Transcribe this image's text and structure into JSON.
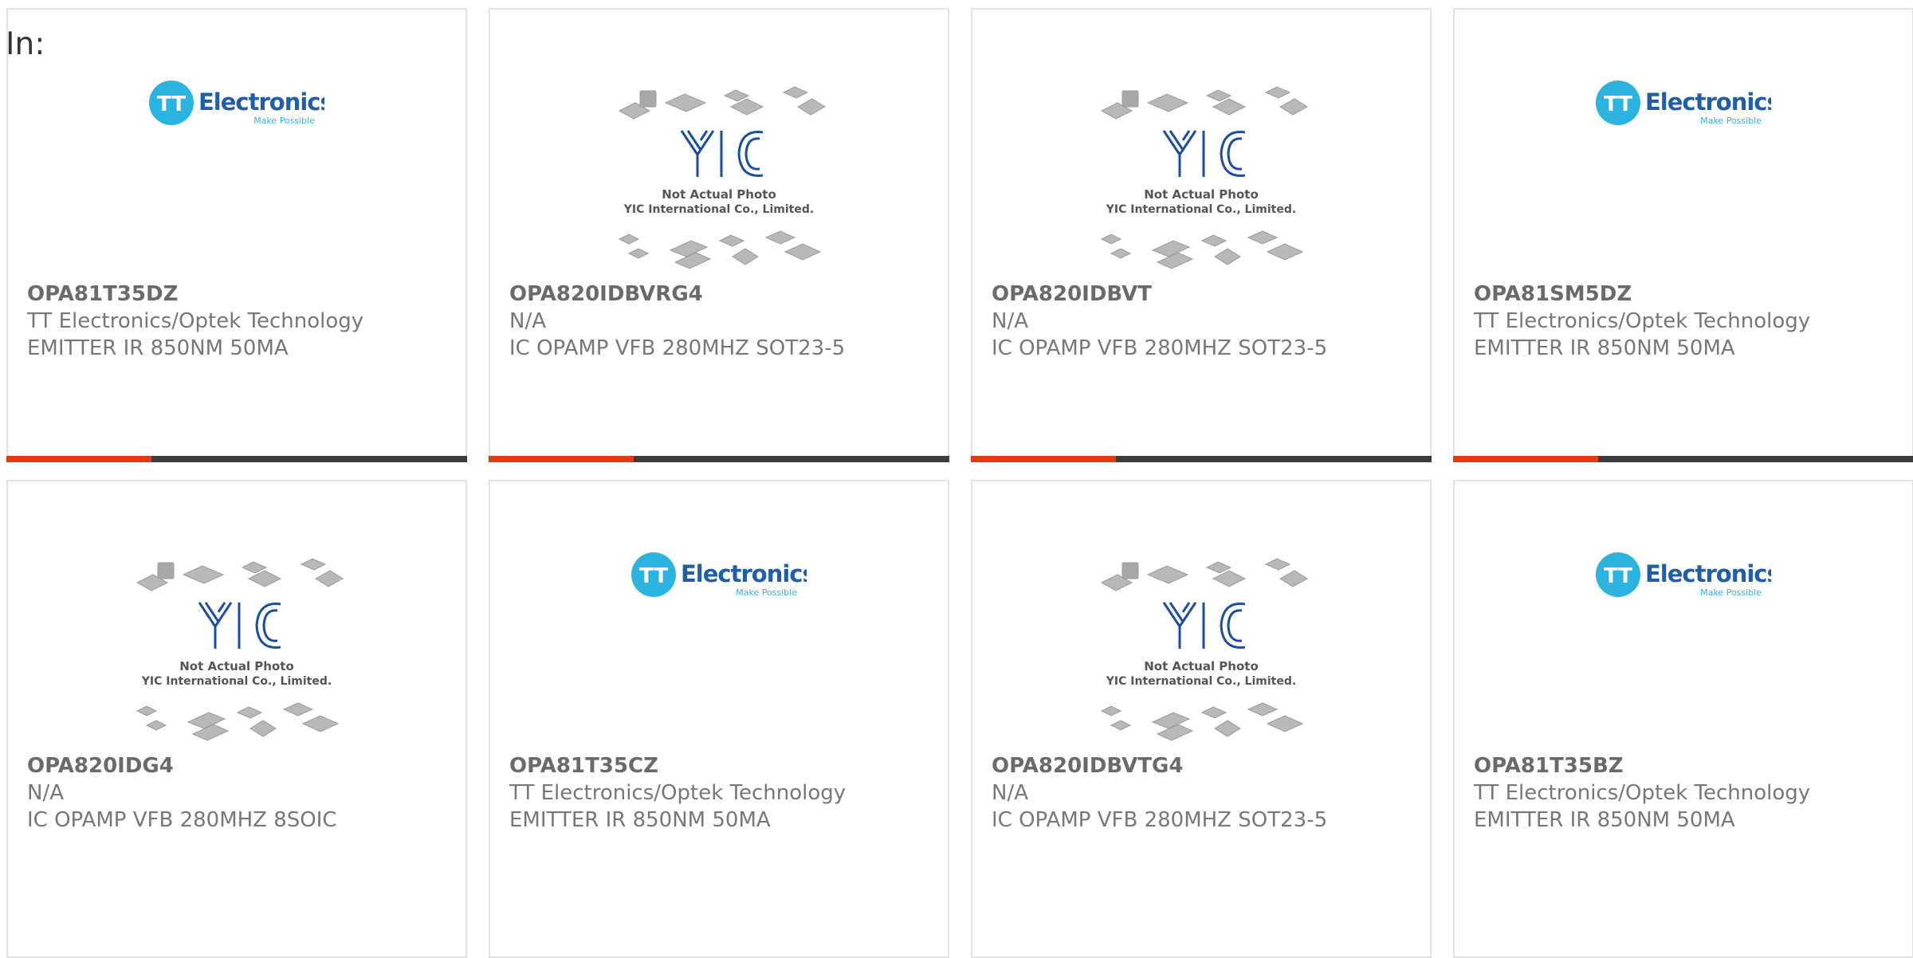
{
  "header": {
    "in_label": "In:"
  },
  "colors": {
    "tt_blue": "#2bb4e0",
    "yic_blue": "#1a4f9e",
    "accent_bar": "#e23a0e",
    "dark_bar": "#3c3c3c"
  },
  "logos": {
    "tt": {
      "main": "Electronics",
      "tagline": "Make Possible",
      "badge": "TT"
    },
    "yic": {
      "mark": "YIC",
      "line1": "Not Actual Photo",
      "line2": "YIC International Co., Limited."
    }
  },
  "products": [
    {
      "part_number": "OPA81T35DZ",
      "manufacturer": "TT Electronics/Optek Technology",
      "description": "EMITTER IR 850NM 50MA",
      "image": "tt-electronics-logo"
    },
    {
      "part_number": "OPA820IDBVRG4",
      "manufacturer": "N/A",
      "description": "IC OPAMP VFB 280MHZ SOT23-5",
      "image": "yic-placeholder"
    },
    {
      "part_number": "OPA820IDBVT",
      "manufacturer": "N/A",
      "description": "IC OPAMP VFB 280MHZ SOT23-5",
      "image": "yic-placeholder"
    },
    {
      "part_number": "OPA81SM5DZ",
      "manufacturer": "TT Electronics/Optek Technology",
      "description": "EMITTER IR 850NM 50MA",
      "image": "tt-electronics-logo"
    },
    {
      "part_number": "OPA820IDG4",
      "manufacturer": "N/A",
      "description": "IC OPAMP VFB 280MHZ 8SOIC",
      "image": "yic-placeholder"
    },
    {
      "part_number": "OPA81T35CZ",
      "manufacturer": "TT Electronics/Optek Technology",
      "description": "EMITTER IR 850NM 50MA",
      "image": "tt-electronics-logo"
    },
    {
      "part_number": "OPA820IDBVTG4",
      "manufacturer": "N/A",
      "description": "IC OPAMP VFB 280MHZ SOT23-5",
      "image": "yic-placeholder"
    },
    {
      "part_number": "OPA81T35BZ",
      "manufacturer": "TT Electronics/Optek Technology",
      "description": "EMITTER IR 850NM 50MA",
      "image": "tt-electronics-logo"
    }
  ]
}
